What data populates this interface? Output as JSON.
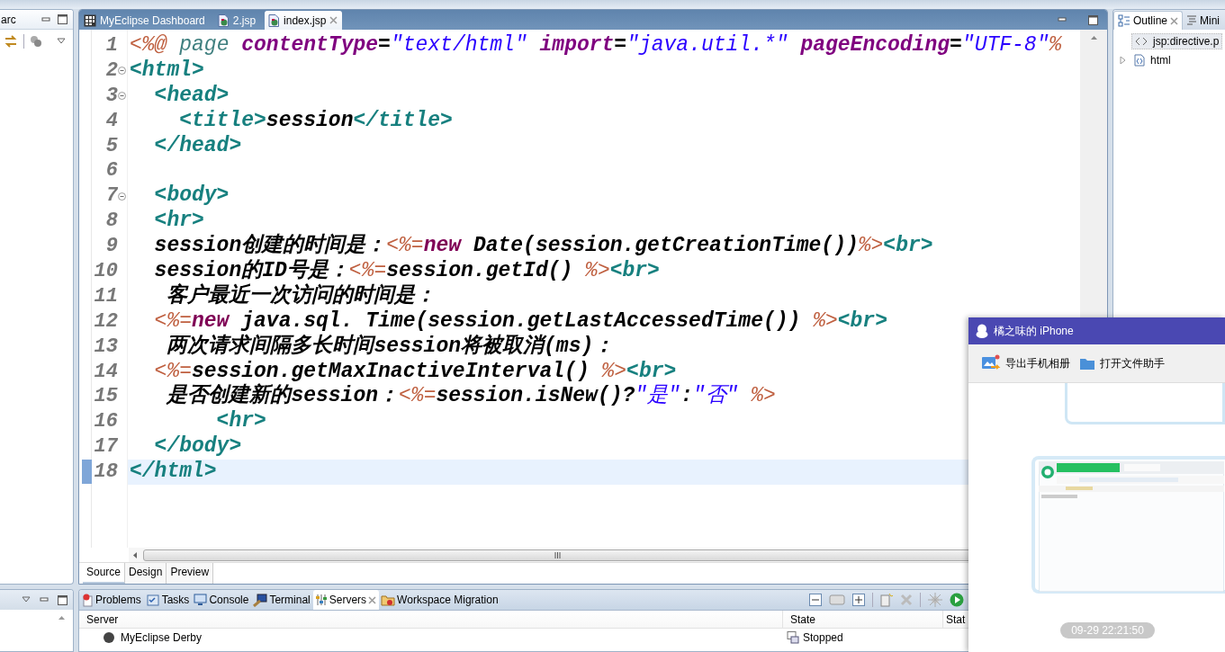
{
  "left_panel": {
    "tab": "arc"
  },
  "editor": {
    "tabs": [
      {
        "label": "MyEclipse Dashboard",
        "kind": "dashboard",
        "selected": false
      },
      {
        "label": "2.jsp",
        "kind": "jsp",
        "selected": false
      },
      {
        "label": "index.jsp",
        "kind": "jsp",
        "selected": true
      }
    ],
    "lines": [
      {
        "number": "1",
        "foldable": false,
        "current": false,
        "tokens": [
          {
            "kind": "directive",
            "text": "<%@"
          },
          {
            "kind": "directive_name",
            "text": " page"
          },
          {
            "kind": "attr",
            "text": " contentType"
          },
          {
            "kind": "op",
            "text": "="
          },
          {
            "kind": "value",
            "text": "\"text/html\""
          },
          {
            "kind": "attr",
            "text": " import"
          },
          {
            "kind": "op",
            "text": "="
          },
          {
            "kind": "value",
            "text": "\"java.util.*\""
          },
          {
            "kind": "attr",
            "text": " pageEncoding"
          },
          {
            "kind": "op",
            "text": "="
          },
          {
            "kind": "value",
            "text": "\"UTF-8\""
          },
          {
            "kind": "directive",
            "text": "%"
          }
        ]
      },
      {
        "number": "2",
        "foldable": true,
        "current": false,
        "tokens": [
          {
            "kind": "tag",
            "text": "<html>"
          }
        ]
      },
      {
        "number": "3",
        "foldable": true,
        "current": false,
        "tokens": [
          {
            "kind": "tag",
            "text": "  <head>"
          }
        ]
      },
      {
        "number": "4",
        "foldable": false,
        "current": false,
        "tokens": [
          {
            "kind": "tag",
            "text": "    <title>"
          },
          {
            "kind": "text",
            "text": "session"
          },
          {
            "kind": "tag",
            "text": "</title>"
          }
        ]
      },
      {
        "number": "5",
        "foldable": false,
        "current": false,
        "tokens": [
          {
            "kind": "tag",
            "text": "  </head>"
          }
        ]
      },
      {
        "number": "6",
        "foldable": false,
        "current": false
      },
      {
        "number": "7",
        "foldable": true,
        "current": false,
        "tokens": [
          {
            "kind": "tag",
            "text": "  <body>"
          }
        ]
      },
      {
        "number": "8",
        "foldable": false,
        "current": false,
        "tokens": [
          {
            "kind": "tag",
            "text": "  <hr>"
          }
        ]
      },
      {
        "number": "9",
        "foldable": false,
        "current": false,
        "tokens": [
          {
            "kind": "text",
            "text": "  session创建的时间是："
          },
          {
            "kind": "directive",
            "text": "<%="
          },
          {
            "kind": "keyword",
            "text": "new"
          },
          {
            "kind": "code",
            "text": " Date(session.getCreationTime())"
          },
          {
            "kind": "directive",
            "text": "%>"
          },
          {
            "kind": "tag",
            "text": "<br>"
          }
        ]
      },
      {
        "number": "10",
        "foldable": false,
        "current": false,
        "tokens": [
          {
            "kind": "text",
            "text": "  session的ID号是："
          },
          {
            "kind": "directive",
            "text": "<%="
          },
          {
            "kind": "code",
            "text": "session.getId() "
          },
          {
            "kind": "directive",
            "text": "%>"
          },
          {
            "kind": "tag",
            "text": "<br>"
          }
        ]
      },
      {
        "number": "11",
        "foldable": false,
        "current": false,
        "tokens": [
          {
            "kind": "text",
            "text": "   客户最近一次访问的时间是："
          }
        ]
      },
      {
        "number": "12",
        "foldable": false,
        "current": false,
        "tokens": [
          {
            "kind": "directive",
            "text": "  <%="
          },
          {
            "kind": "keyword",
            "text": "new"
          },
          {
            "kind": "code",
            "text": " java.sql. Time(session.getLastAccessedTime()) "
          },
          {
            "kind": "directive",
            "text": "%>"
          },
          {
            "kind": "tag",
            "text": "<br>"
          }
        ]
      },
      {
        "number": "13",
        "foldable": false,
        "current": false,
        "tokens": [
          {
            "kind": "text",
            "text": "   两次请求间隔多长时间session将被取消(ms)："
          }
        ]
      },
      {
        "number": "14",
        "foldable": false,
        "current": false,
        "tokens": [
          {
            "kind": "directive",
            "text": "  <%="
          },
          {
            "kind": "code",
            "text": "session.getMaxInactiveInterval() "
          },
          {
            "kind": "directive",
            "text": "%>"
          },
          {
            "kind": "tag",
            "text": "<br>"
          }
        ]
      },
      {
        "number": "15",
        "foldable": false,
        "current": false,
        "tokens": [
          {
            "kind": "text",
            "text": "   是否创建新的session："
          },
          {
            "kind": "directive",
            "text": "<%="
          },
          {
            "kind": "code",
            "text": "session.isNew()?"
          },
          {
            "kind": "value",
            "text": "\"是\""
          },
          {
            "kind": "code",
            "text": ":"
          },
          {
            "kind": "value",
            "text": "\"否\""
          },
          {
            "kind": "directive",
            "text": " %>"
          }
        ]
      },
      {
        "number": "16",
        "foldable": false,
        "current": false,
        "tokens": [
          {
            "kind": "tag",
            "text": "       <hr>"
          }
        ]
      },
      {
        "number": "17",
        "foldable": false,
        "current": false,
        "tokens": [
          {
            "kind": "tag",
            "text": "  </body>"
          }
        ]
      },
      {
        "number": "18",
        "foldable": false,
        "current": true,
        "tokens": [
          {
            "kind": "tag",
            "text": "</html>"
          }
        ]
      }
    ],
    "bottom_tabs": [
      {
        "label": "Source",
        "selected": true
      },
      {
        "label": "Design",
        "selected": false
      },
      {
        "label": "Preview",
        "selected": false
      }
    ]
  },
  "outline": {
    "tabs": [
      {
        "label": "Outline",
        "kind": "outline",
        "selected": true
      },
      {
        "label": "Mini",
        "kind": "mini",
        "selected": false
      }
    ],
    "items": [
      {
        "label": "jsp:directive.p",
        "kind": "directive",
        "selected": true
      },
      {
        "label": "html",
        "kind": "element",
        "selected": false,
        "expanded": false
      }
    ]
  },
  "bottom_panel": {
    "tabs": [
      {
        "label": "Problems",
        "kind": "problems",
        "selected": false
      },
      {
        "label": "Tasks",
        "kind": "tasks",
        "selected": false
      },
      {
        "label": "Console",
        "kind": "console",
        "selected": false
      },
      {
        "label": "Terminal",
        "kind": "terminal",
        "selected": false
      },
      {
        "label": "Servers",
        "kind": "servers",
        "selected": true
      },
      {
        "label": "Workspace Migration",
        "kind": "migration",
        "selected": false
      }
    ],
    "columns": [
      "Server",
      "State",
      "Stat"
    ],
    "rows": [
      {
        "server": "MyEclipse Derby",
        "state": "Stopped"
      }
    ]
  },
  "phone_window": {
    "title": "橘之味的 iPhone",
    "actions": [
      {
        "label": "导出手机相册",
        "kind": "album"
      },
      {
        "label": "打开文件助手",
        "kind": "folder"
      }
    ],
    "timestamp": "09-29 22:21:50"
  }
}
